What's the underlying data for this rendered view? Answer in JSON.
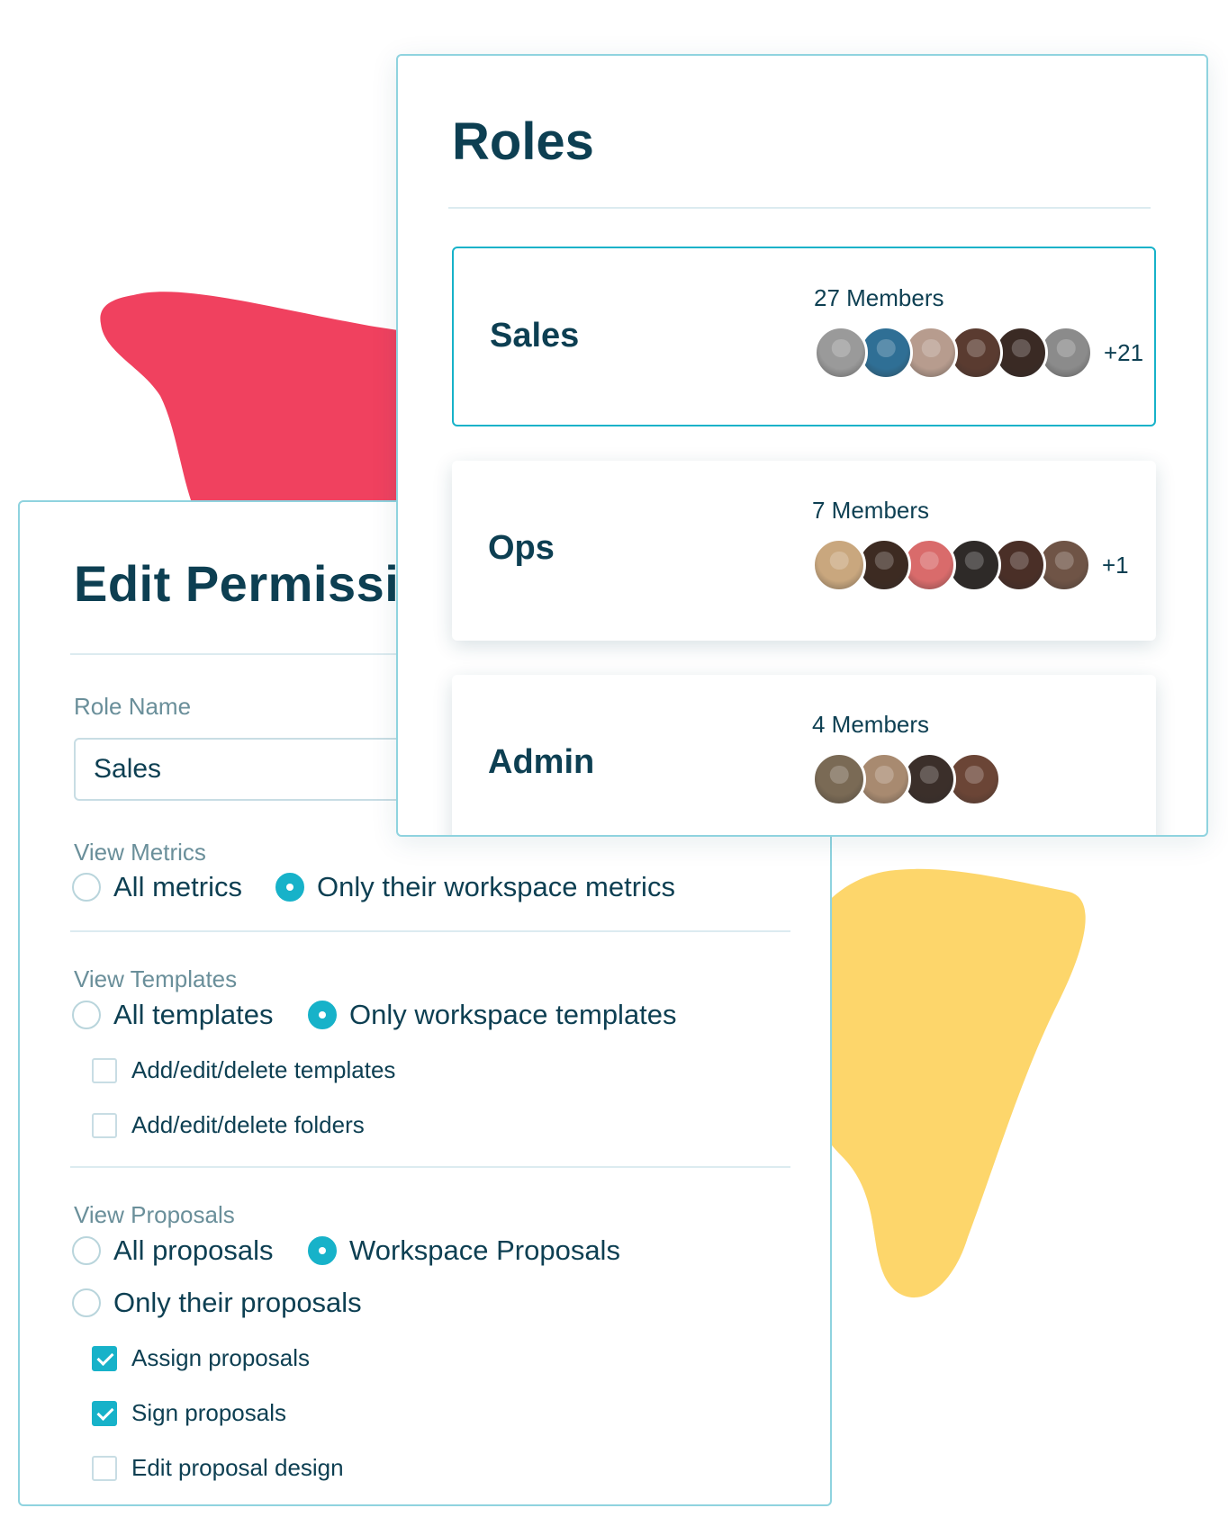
{
  "colors": {
    "accent": "#17b2c9",
    "text": "#0d3f52",
    "muted": "#6a8f9a",
    "border": "#8fd3df",
    "blob_red": "#f0415f",
    "blob_yellow": "#fdd66b"
  },
  "edit_permissions": {
    "title": "Edit Permissions",
    "role_name_label": "Role Name",
    "role_name_value": "Sales",
    "view_metrics": {
      "label": "View Metrics",
      "options": [
        {
          "label": "All metrics",
          "selected": false
        },
        {
          "label": "Only their workspace metrics",
          "selected": true
        }
      ]
    },
    "view_templates": {
      "label": "View Templates",
      "options": [
        {
          "label": "All templates",
          "selected": false
        },
        {
          "label": "Only workspace templates",
          "selected": true
        }
      ],
      "checkboxes": [
        {
          "label": "Add/edit/delete templates",
          "checked": false
        },
        {
          "label": "Add/edit/delete folders",
          "checked": false
        }
      ]
    },
    "view_proposals": {
      "label": "View Proposals",
      "options": [
        {
          "label": "All proposals",
          "selected": false
        },
        {
          "label": "Workspace Proposals",
          "selected": true
        },
        {
          "label": "Only their proposals",
          "selected": false
        }
      ],
      "checkboxes": [
        {
          "label": "Assign proposals",
          "checked": true
        },
        {
          "label": "Sign proposals",
          "checked": true
        },
        {
          "label": "Edit proposal design",
          "checked": false
        }
      ]
    }
  },
  "roles": {
    "title": "Roles",
    "items": [
      {
        "name": "Sales",
        "members": "27 Members",
        "more": "+21",
        "selected": true,
        "avatars": [
          "#9a9a9a",
          "#2f6f95",
          "#b79c8e",
          "#5a3b30",
          "#3a2a24",
          "#8b8b8b"
        ]
      },
      {
        "name": "Ops",
        "members": "7 Members",
        "more": "+1",
        "selected": false,
        "avatars": [
          "#c9a77e",
          "#3d2b22",
          "#d96b6b",
          "#2e2a28",
          "#4a2f27",
          "#6f5446"
        ]
      },
      {
        "name": "Admin",
        "members": "4 Members",
        "more": "",
        "selected": false,
        "avatars": [
          "#7a6a55",
          "#a88a70",
          "#3b2f2a",
          "#6b4536"
        ]
      }
    ]
  }
}
